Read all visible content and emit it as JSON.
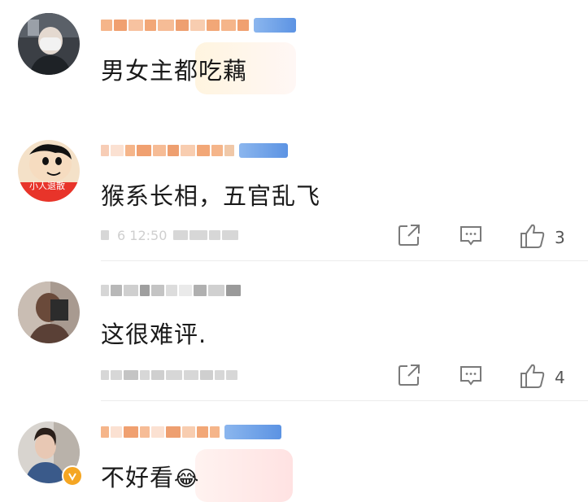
{
  "comments": [
    {
      "avatar": "masked-person-avatar",
      "text": "男女主都吃藕",
      "likes": ""
    },
    {
      "avatar": "cartoon-boy-avatar",
      "avatar_caption": "小人退散",
      "text": "猴系长相，五官乱飞",
      "timestamp": "6 12:50",
      "likes": "3"
    },
    {
      "avatar": "portrait-avatar",
      "text": "这很难评.",
      "likes": "4"
    },
    {
      "avatar": "woman-portrait-avatar",
      "text": "不好看",
      "emoji": "😂",
      "likes": ""
    }
  ],
  "icons": {
    "share": "share-icon",
    "comment": "comment-icon",
    "like": "thumbs-up-icon"
  },
  "colors": {
    "text": "#1a1a1a",
    "icon": "#7a7a7a",
    "divider": "#ececec",
    "badge": "#6fa0e8",
    "name_blur": "#f2a777"
  }
}
